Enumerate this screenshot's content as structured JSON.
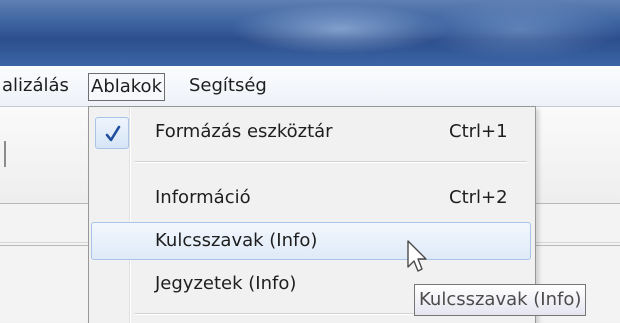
{
  "menubar": {
    "items": [
      {
        "label": "alizálás",
        "active": false
      },
      {
        "label": "Ablakok",
        "active": true
      },
      {
        "label": "Segítség",
        "active": false
      }
    ]
  },
  "dropdown": {
    "items": [
      {
        "label": "Formázás eszköztár",
        "shortcut": "Ctrl+1",
        "checked": true,
        "icon": "checkmark-icon"
      },
      {
        "label": "Információ",
        "shortcut": "Ctrl+2",
        "checked": false
      },
      {
        "label": "Kulcsszavak (Info)",
        "shortcut": "",
        "highlighted": true
      },
      {
        "label": "Jegyzetek (Info)",
        "shortcut": ""
      }
    ]
  },
  "tooltip": {
    "text": "Kulcsszavak (Info)"
  },
  "cursor": {
    "icon": "mouse-pointer-icon"
  },
  "colors": {
    "titlebar": "#3d63a0",
    "highlight_border": "#a8c4e6",
    "checkmark": "#1f4e9e"
  }
}
